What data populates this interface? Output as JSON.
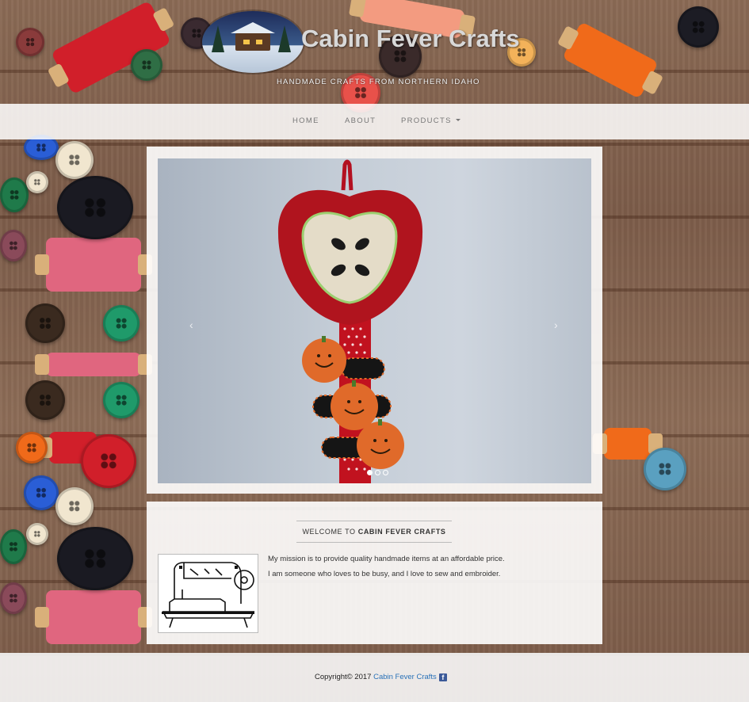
{
  "site": {
    "title": "Cabin Fever Crafts",
    "tagline": "HANDMADE CRAFTS FROM NORTHERN IDAHO"
  },
  "nav": {
    "items": [
      {
        "label": "HOME"
      },
      {
        "label": "ABOUT"
      },
      {
        "label": "PRODUCTS"
      }
    ]
  },
  "carousel": {
    "prev_glyph": "‹",
    "next_glyph": "›",
    "slide_count": 3,
    "active_slide": 1
  },
  "welcome": {
    "heading_prefix": "WELCOME TO",
    "heading_name": "CABIN FEVER CRAFTS",
    "mission": "My mission is to provide quality handmade items at an affordable price.",
    "about": "I am someone who loves to be busy, and I love to sew and embroider."
  },
  "footer": {
    "copyright": "Copyright© 2017",
    "link_text": "Cabin Fever Crafts",
    "facebook_icon": "f"
  },
  "icons": {
    "caret": "caret-down-icon",
    "facebook": "facebook-icon"
  },
  "colors": {
    "link": "#2a72b8",
    "facebook": "#3b5998",
    "apple_red": "#b0141e",
    "pumpkin": "#e06a2a"
  }
}
